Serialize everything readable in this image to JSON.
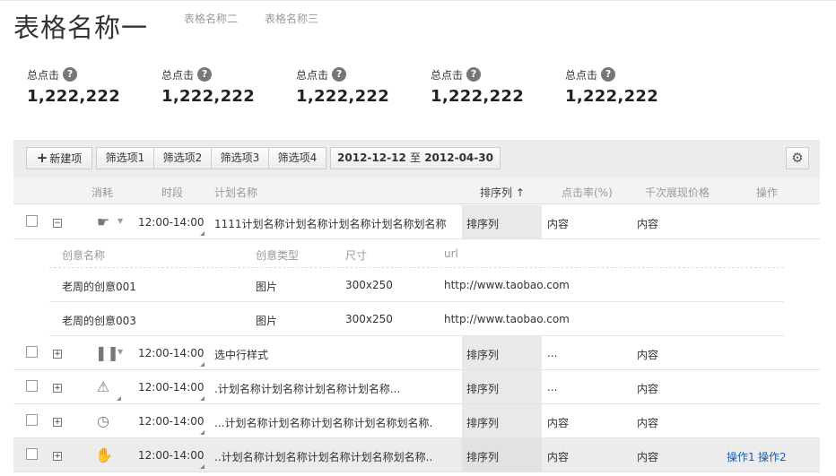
{
  "header": {
    "title": "表格名称一",
    "alt_tabs": [
      "表格名称二",
      "表格名称三"
    ]
  },
  "stats": [
    {
      "label": "总点击",
      "value": "1,222,222"
    },
    {
      "label": "总点击",
      "value": "1,222,222"
    },
    {
      "label": "总点击",
      "value": "1,222,222"
    },
    {
      "label": "总点击",
      "value": "1,222,222"
    },
    {
      "label": "总点击",
      "value": "1,222,222"
    }
  ],
  "toolbar": {
    "new_item": "新建项",
    "filters": [
      "筛选项1",
      "筛选项2",
      "筛选项3",
      "筛选项4"
    ],
    "date_start": "2012-12-12",
    "date_sep": "至",
    "date_end": "2012-04-30",
    "settings_icon": "gear-icon"
  },
  "columns": {
    "consume": "消耗",
    "period": "时段",
    "plan_name": "计划名称",
    "sort": "排序列 ↑",
    "ctr": "点击率(%)",
    "cpm": "千次展现价格",
    "ops": "操作"
  },
  "rows": [
    {
      "toggle": "−",
      "icon": "pointing-hand-icon",
      "time": "12:00-14:00",
      "name": "1111计划名称计划名称计划名称计划名称划名称",
      "sort": "排序列",
      "ctr": "内容",
      "cpm": "内容",
      "ops": []
    },
    {
      "toggle": "+",
      "icon": "pause-icon",
      "time": "12:00-14:00",
      "name": "选中行样式",
      "sort": "排序列",
      "ctr": "...",
      "cpm": "内容",
      "ops": []
    },
    {
      "toggle": "+",
      "icon": "warning-icon",
      "time": "12:00-14:00",
      "name": ".计划名称计划名称计划名称计划名称...",
      "sort": "排序列",
      "ctr": "...",
      "cpm": "内容",
      "ops": []
    },
    {
      "toggle": "+",
      "icon": "clock-icon",
      "time": "12:00-14:00",
      "name": "...计划名称计划名称计划名称计划名称划名称.",
      "sort": "排序列",
      "ctr": "内容",
      "cpm": "内容",
      "ops": []
    },
    {
      "toggle": "+",
      "icon": "hand-icon",
      "time": "12:00-14:00",
      "name": "..计划名称计划名称计划名称计划名称划名称..",
      "sort": "排序列",
      "ctr": "内容",
      "cpm": "内容",
      "ops": [
        "操作1",
        "操作2"
      ]
    }
  ],
  "sub_table": {
    "columns": [
      "创意名称",
      "创意类型",
      "尺寸",
      "url"
    ],
    "rows": [
      [
        "老周的创意001",
        "图片",
        "300x250",
        "http://www.taobao.com"
      ],
      [
        "老周的创意003",
        "图片",
        "300x250",
        "http://www.taobao.com"
      ]
    ]
  }
}
